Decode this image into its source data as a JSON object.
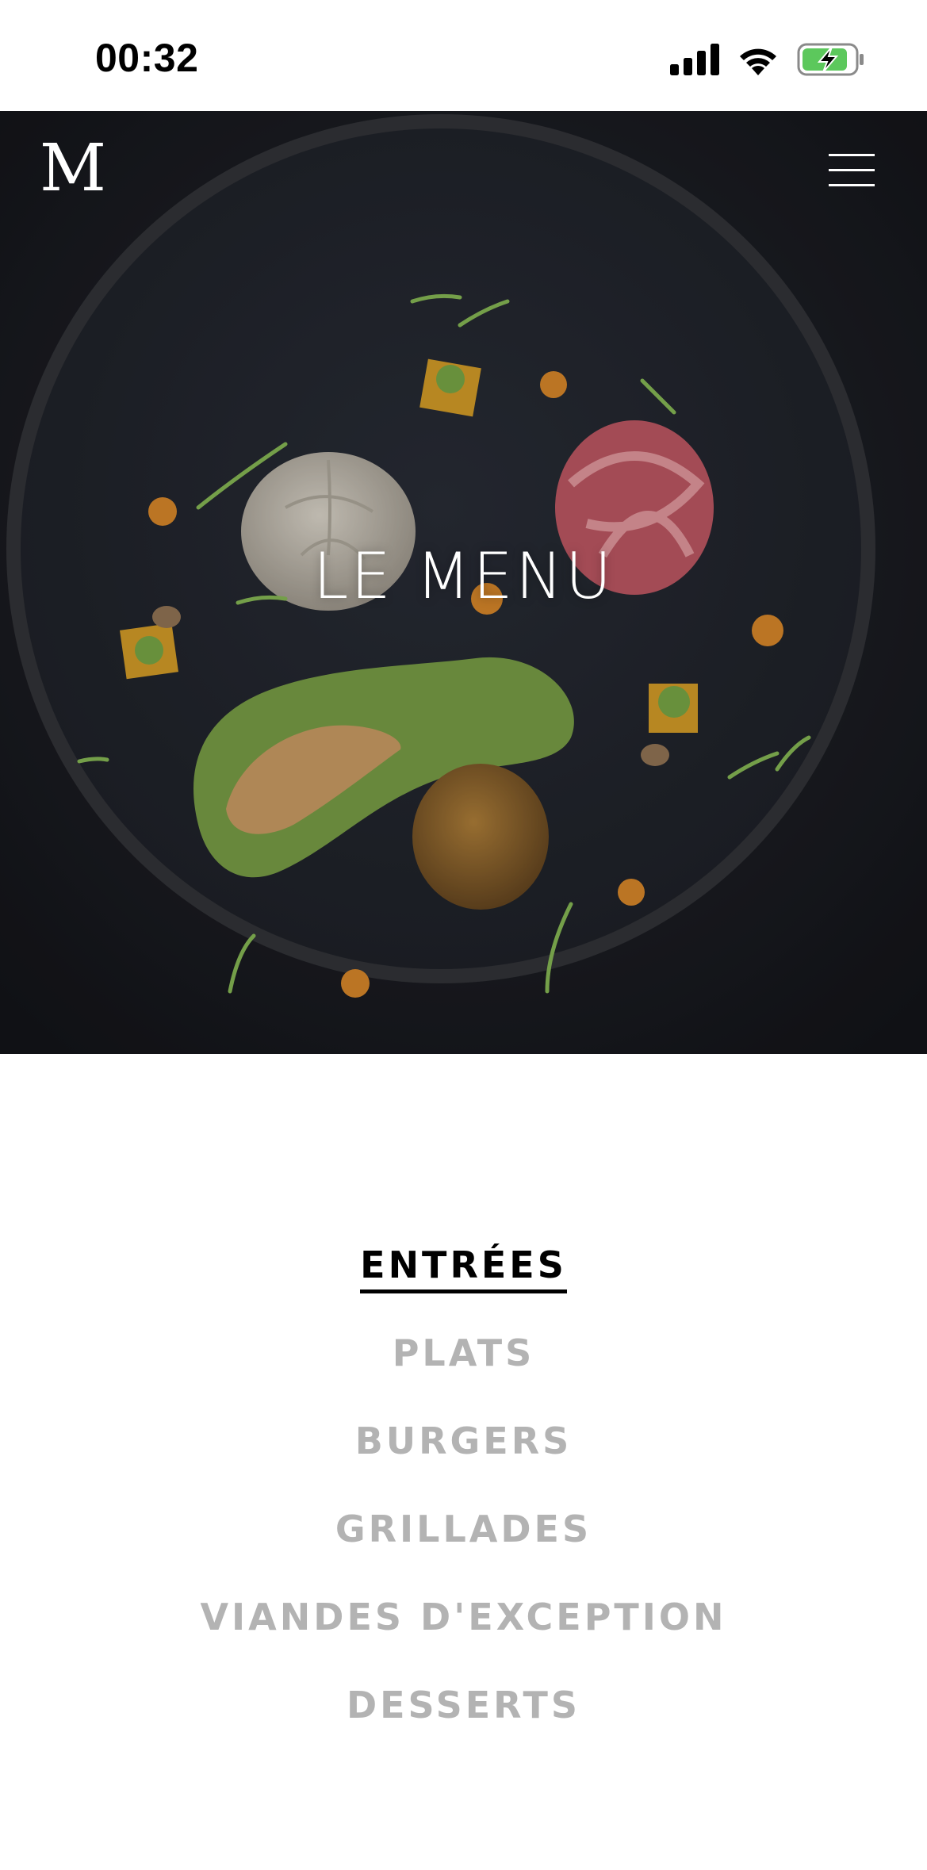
{
  "status_bar": {
    "time": "00:32",
    "icons": [
      "cellular-signal-icon",
      "wifi-icon",
      "battery-charging-icon"
    ],
    "battery_color": "#5cc85c"
  },
  "header": {
    "logo_text": "M",
    "menu_icon": "hamburger-menu-icon"
  },
  "hero": {
    "title": "LE MENU"
  },
  "categories": {
    "items": [
      {
        "label": "ENTRÉES",
        "active": true
      },
      {
        "label": "PLATS",
        "active": false
      },
      {
        "label": "BURGERS",
        "active": false
      },
      {
        "label": "GRILLADES",
        "active": false
      },
      {
        "label": "VIANDES D'EXCEPTION",
        "active": false
      },
      {
        "label": "DESSERTS",
        "active": false
      }
    ],
    "active_color": "#000000",
    "inactive_color": "#b3b3b3"
  }
}
